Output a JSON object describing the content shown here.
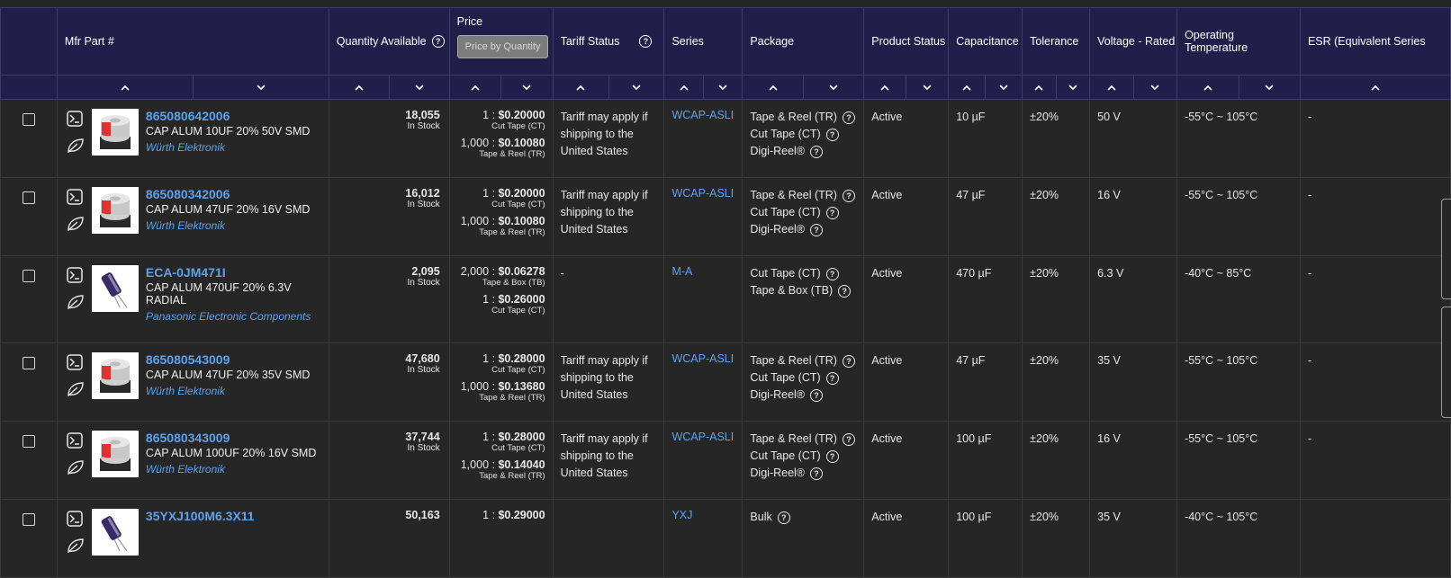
{
  "headers": {
    "mfr_part": "Mfr Part #",
    "quantity": "Quantity Available",
    "price": "Price",
    "price_button": "Price by Quantity",
    "tariff": "Tariff Status",
    "series": "Series",
    "package": "Package",
    "product_status": "Product Status",
    "capacitance": "Capacitance",
    "tolerance": "Tolerance",
    "voltage": "Voltage - Rated",
    "op_temp": "Operating Temperature",
    "esr": "ESR (Equivalent Series"
  },
  "icons": {
    "sort_up": "chevron-up-icon",
    "sort_down": "chevron-down-icon",
    "help": "help-circle-icon",
    "datasheet": "datasheet-icon",
    "eco": "leaf-icon"
  },
  "colors": {
    "header_bg": "#221e4a",
    "link": "#5aa3f0",
    "row_bg": "#262626"
  },
  "rows": [
    {
      "part": "865080642006",
      "desc": "CAP ALUM 10UF 20% 50V SMD",
      "mfr": "Würth Elektronik",
      "qty": "18,055",
      "stock": "In Stock",
      "prices": [
        {
          "qty": "1 : ",
          "price": "$0.20000",
          "pack": "Cut Tape (CT)"
        },
        {
          "qty": "1,000 : ",
          "price": "$0.10080",
          "pack": "Tape & Reel (TR)"
        }
      ],
      "tariff": "Tariff may apply if shipping to the United States",
      "series": "WCAP-ASLI",
      "packages": [
        "Tape & Reel (TR)",
        "Cut Tape (CT)",
        "Digi-Reel®"
      ],
      "status": "Active",
      "capacitance": "10 µF",
      "tolerance": "±20%",
      "voltage": "50 V",
      "temp": "-55°C ~ 105°C",
      "esr": "-",
      "image": "smd"
    },
    {
      "part": "865080342006",
      "desc": "CAP ALUM 47UF 20% 16V SMD",
      "mfr": "Würth Elektronik",
      "qty": "16,012",
      "stock": "In Stock",
      "prices": [
        {
          "qty": "1 : ",
          "price": "$0.20000",
          "pack": "Cut Tape (CT)"
        },
        {
          "qty": "1,000 : ",
          "price": "$0.10080",
          "pack": "Tape & Reel (TR)"
        }
      ],
      "tariff": "Tariff may apply if shipping to the United States",
      "series": "WCAP-ASLI",
      "packages": [
        "Tape & Reel (TR)",
        "Cut Tape (CT)",
        "Digi-Reel®"
      ],
      "status": "Active",
      "capacitance": "47 µF",
      "tolerance": "±20%",
      "voltage": "16 V",
      "temp": "-55°C ~ 105°C",
      "esr": "-",
      "image": "smd"
    },
    {
      "part": "ECA-0JM471I",
      "desc": "CAP ALUM 470UF 20% 6.3V RADIAL",
      "mfr": "Panasonic Electronic Components",
      "qty": "2,095",
      "stock": "In Stock",
      "prices": [
        {
          "qty": "2,000 : ",
          "price": "$0.06278",
          "pack": "Tape & Box (TB)"
        },
        {
          "qty": "1 : ",
          "price": "$0.26000",
          "pack": "Cut Tape (CT)"
        }
      ],
      "tariff": "-",
      "series": "M-A",
      "packages": [
        "Cut Tape (CT)",
        "Tape & Box (TB)"
      ],
      "status": "Active",
      "capacitance": "470 µF",
      "tolerance": "±20%",
      "voltage": "6.3 V",
      "temp": "-40°C ~ 85°C",
      "esr": "-",
      "image": "radial"
    },
    {
      "part": "865080543009",
      "desc": "CAP ALUM 47UF 20% 35V SMD",
      "mfr": "Würth Elektronik",
      "qty": "47,680",
      "stock": "In Stock",
      "prices": [
        {
          "qty": "1 : ",
          "price": "$0.28000",
          "pack": "Cut Tape (CT)"
        },
        {
          "qty": "1,000 : ",
          "price": "$0.13680",
          "pack": "Tape & Reel (TR)"
        }
      ],
      "tariff": "Tariff may apply if shipping to the United States",
      "series": "WCAP-ASLI",
      "packages": [
        "Tape & Reel (TR)",
        "Cut Tape (CT)",
        "Digi-Reel®"
      ],
      "status": "Active",
      "capacitance": "47 µF",
      "tolerance": "±20%",
      "voltage": "35 V",
      "temp": "-55°C ~ 105°C",
      "esr": "-",
      "image": "smd"
    },
    {
      "part": "865080343009",
      "desc": "CAP ALUM 100UF 20% 16V SMD",
      "mfr": "Würth Elektronik",
      "qty": "37,744",
      "stock": "In Stock",
      "prices": [
        {
          "qty": "1 : ",
          "price": "$0.28000",
          "pack": "Cut Tape (CT)"
        },
        {
          "qty": "1,000 : ",
          "price": "$0.14040",
          "pack": "Tape & Reel (TR)"
        }
      ],
      "tariff": "Tariff may apply if shipping to the United States",
      "series": "WCAP-ASLI",
      "packages": [
        "Tape & Reel (TR)",
        "Cut Tape (CT)",
        "Digi-Reel®"
      ],
      "status": "Active",
      "capacitance": "100 µF",
      "tolerance": "±20%",
      "voltage": "16 V",
      "temp": "-55°C ~ 105°C",
      "esr": "-",
      "image": "smd"
    },
    {
      "part": "35YXJ100M6.3X11",
      "desc": "",
      "mfr": "",
      "qty": "50,163",
      "stock": "",
      "prices": [
        {
          "qty": "1 : ",
          "price": "$0.29000",
          "pack": ""
        }
      ],
      "tariff": "",
      "series": "YXJ",
      "packages": [
        "Bulk"
      ],
      "status": "Active",
      "capacitance": "100 µF",
      "tolerance": "±20%",
      "voltage": "35 V",
      "temp": "-40°C ~ 105°C",
      "esr": "",
      "image": "radial"
    }
  ]
}
